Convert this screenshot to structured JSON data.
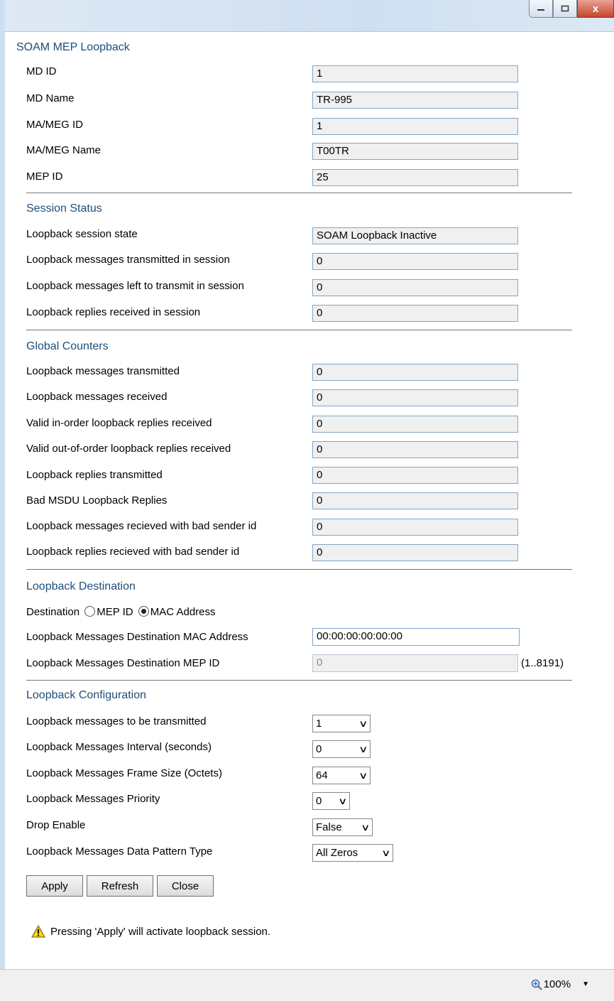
{
  "window": {
    "minimize_icon": "minimize-icon",
    "maximize_icon": "maximize-icon",
    "close_label": "x"
  },
  "page_title": "SOAM MEP Loopback",
  "identity": [
    {
      "label": "MD ID",
      "value": "1"
    },
    {
      "label": "MD Name",
      "value": "TR-995"
    },
    {
      "label": "MA/MEG ID",
      "value": "1"
    },
    {
      "label": "MA/MEG Name",
      "value": "T00TR"
    },
    {
      "label": "MEP ID",
      "value": "25"
    }
  ],
  "session_status": {
    "title": "Session Status",
    "rows": [
      {
        "label": "Loopback session state",
        "value": "SOAM Loopback Inactive"
      },
      {
        "label": "Loopback messages transmitted in session",
        "value": "0"
      },
      {
        "label": "Loopback messages left to transmit in session",
        "value": "0"
      },
      {
        "label": "Loopback replies received in session",
        "value": "0"
      }
    ]
  },
  "global_counters": {
    "title": "Global Counters",
    "rows": [
      {
        "label": "Loopback messages transmitted",
        "value": "0"
      },
      {
        "label": "Loopback messages received",
        "value": "0"
      },
      {
        "label": "Valid in-order loopback replies received",
        "value": "0"
      },
      {
        "label": "Valid out-of-order loopback replies received",
        "value": "0"
      },
      {
        "label": "Loopback replies transmitted",
        "value": "0"
      },
      {
        "label": "Bad MSDU Loopback Replies",
        "value": "0"
      },
      {
        "label": "Loopback messages recieved with bad sender id",
        "value": "0"
      },
      {
        "label": "Loopback replies recieved with bad sender id",
        "value": "0"
      }
    ]
  },
  "destination": {
    "title": "Loopback Destination",
    "label": "Destination",
    "option_mep": "MEP ID",
    "option_mac": "MAC Address",
    "selected": "MAC Address",
    "mac_label": "Loopback Messages Destination MAC Address",
    "mac_value": "00:00:00:00:00:00",
    "mep_label": "Loopback Messages Destination MEP ID",
    "mep_value": "0",
    "mep_range": "(1..8191)"
  },
  "configuration": {
    "title": "Loopback Configuration",
    "rows": [
      {
        "label": "Loopback messages to be transmitted",
        "value": "1"
      },
      {
        "label": "Loopback Messages Interval (seconds)",
        "value": "0"
      },
      {
        "label": "Loopback Messages Frame Size (Octets)",
        "value": "64"
      },
      {
        "label": "Loopback Messages Priority",
        "value": "0"
      },
      {
        "label": "Drop Enable",
        "value": "False"
      },
      {
        "label": "Loopback Messages Data Pattern Type",
        "value": "All Zeros"
      }
    ]
  },
  "buttons": {
    "apply": "Apply",
    "refresh": "Refresh",
    "close": "Close"
  },
  "warning": {
    "icon": "warning-icon",
    "text": "Pressing 'Apply' will activate loopback session."
  },
  "statusbar": {
    "zoom_icon": "zoom-icon",
    "zoom": "100%",
    "dropdown_icon": "chevron-down-icon"
  }
}
